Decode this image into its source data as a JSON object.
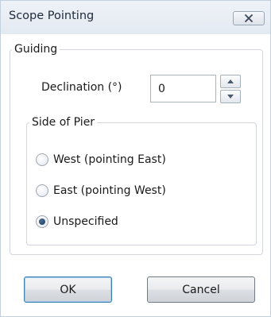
{
  "window": {
    "title": "Scope Pointing",
    "close_icon": "close-x-icon"
  },
  "guiding": {
    "legend": "Guiding",
    "declination_label": "Declination (°)",
    "declination_value": "0",
    "spin_up_icon": "triangle-up-icon",
    "spin_down_icon": "triangle-down-icon"
  },
  "side_of_pier": {
    "legend": "Side of Pier",
    "options": [
      {
        "label": "West (pointing East)",
        "checked": false
      },
      {
        "label": "East (pointing West)",
        "checked": false
      },
      {
        "label": "Unspecified",
        "checked": true
      }
    ]
  },
  "buttons": {
    "ok_label": "OK",
    "cancel_label": "Cancel"
  },
  "colors": {
    "title_bar": "#e8ecf2",
    "client_bg": "#ffffff",
    "default_button_border": "#3c7fb1",
    "radio_selected": "#1d3a5c"
  }
}
